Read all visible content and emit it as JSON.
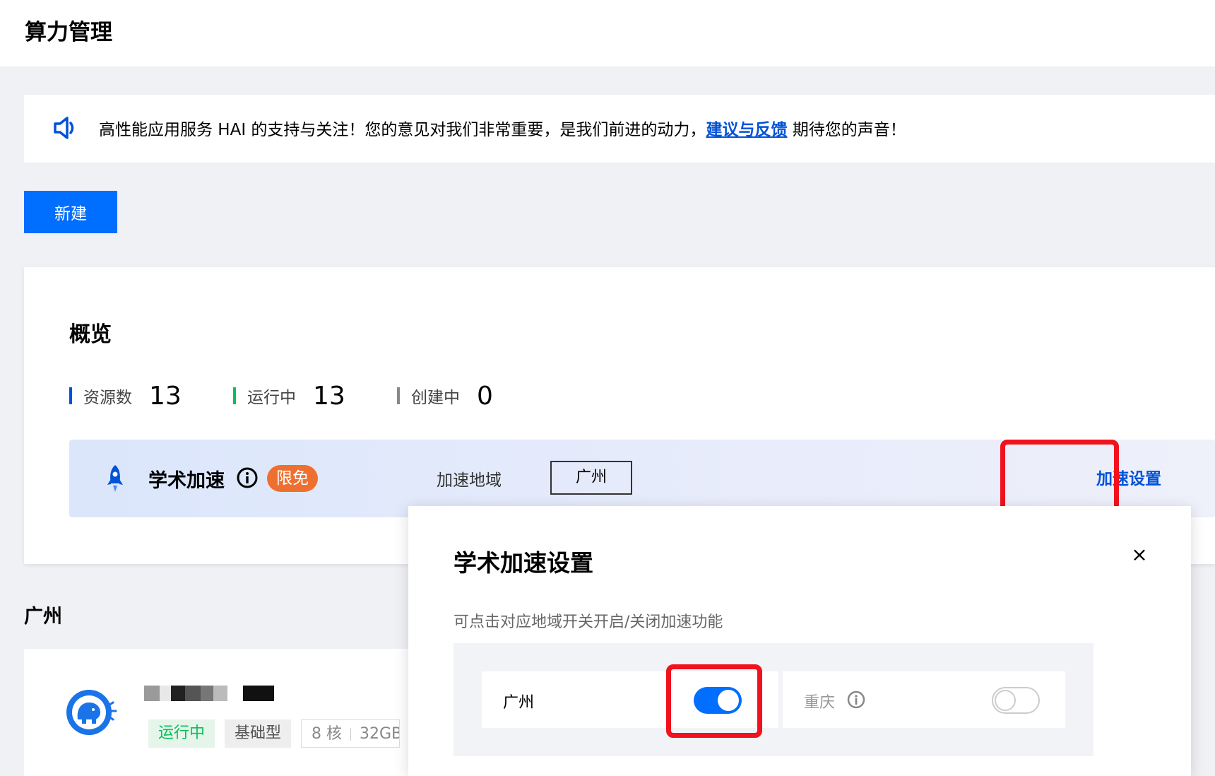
{
  "page": {
    "title": "算力管理"
  },
  "notice": {
    "text_before": "高性能应用服务 HAI 的支持与关注！您的意见对我们非常重要，是我们前进的动力，",
    "link": "建议与反馈",
    "text_after": " 期待您的声音！"
  },
  "toolbar": {
    "new_label": "新建"
  },
  "overview": {
    "title": "概览",
    "stats": [
      {
        "label": "资源数",
        "value": "13",
        "color": "#0052d9"
      },
      {
        "label": "运行中",
        "value": "13",
        "color": "#0abf5b"
      },
      {
        "label": "创建中",
        "value": "0",
        "color": "#888888"
      }
    ]
  },
  "accel": {
    "name": "学术加速",
    "badge": "限免",
    "region_label": "加速地域",
    "region_value": "广州",
    "settings_link": "加速设置"
  },
  "region_section": {
    "heading": "广州"
  },
  "instance": {
    "status": "运行中",
    "type": "基础型",
    "cores": "8 核",
    "memory": "32GB"
  },
  "popover": {
    "title": "学术加速设置",
    "close": "×",
    "description": "可点击对应地域开关开启/关闭加速功能",
    "regions": [
      {
        "name": "广州",
        "enabled": true
      },
      {
        "name": "重庆",
        "enabled": false
      }
    ]
  },
  "colors": {
    "primary": "#006eff",
    "link": "#0052d9",
    "highlight": "#f0121d",
    "badge": "#ee7031",
    "running": "#0abf5b"
  }
}
